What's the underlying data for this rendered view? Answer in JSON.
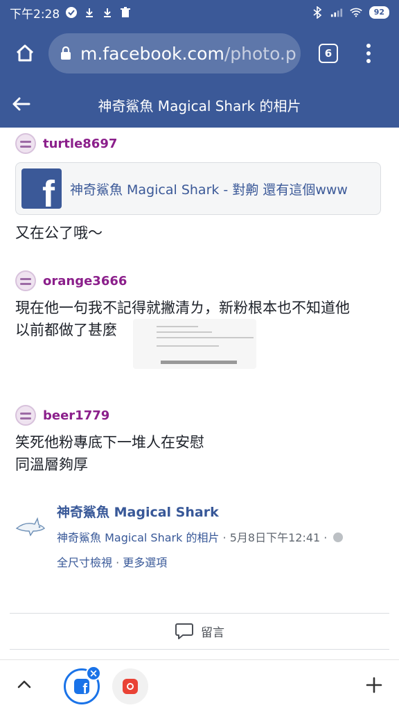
{
  "status_bar": {
    "time": "下午2:28",
    "battery": "92"
  },
  "browser": {
    "url_host": "m.facebook.com",
    "url_path": "/photo.p",
    "tab_count": "6"
  },
  "header": {
    "title": "神奇鯊魚 Magical Shark 的相片"
  },
  "comments": [
    {
      "author": "turtle8697",
      "link_title": "神奇鯊魚 Magical Shark - 對齁 還有這個www",
      "text": "又在公了哦～"
    },
    {
      "author": "orange3666",
      "text_line1": "現在他一句我不記得就撇清ㄌ，新粉根本也不知道他",
      "text_line2": "以前都做了甚麼"
    },
    {
      "author": "beer1779",
      "text_line1": "笑死他粉專底下一堆人在安慰",
      "text_line2": "同溫層夠厚"
    }
  ],
  "page_post": {
    "name": "神奇鯊魚 Magical Shark",
    "meta_link": "神奇鯊魚 Magical Shark 的相片",
    "meta_date": " · 5月8日下午12:41 · ",
    "action_full_size": "全尺寸檢視",
    "action_separator": " · ",
    "action_more": "更多選項"
  },
  "comment_button": {
    "label": "留言"
  },
  "colors": {
    "brand": "#3b5998",
    "author": "#8b1f8b",
    "link": "#385898",
    "tab_accent": "#1a73e8"
  },
  "icons": [
    "home-icon",
    "lock-icon",
    "tabs-icon",
    "overflow-menu-icon",
    "back-arrow-icon",
    "facebook-logo-icon",
    "shark-icon",
    "globe-icon",
    "comment-icon",
    "chevron-up-icon",
    "close-icon",
    "plus-icon"
  ]
}
